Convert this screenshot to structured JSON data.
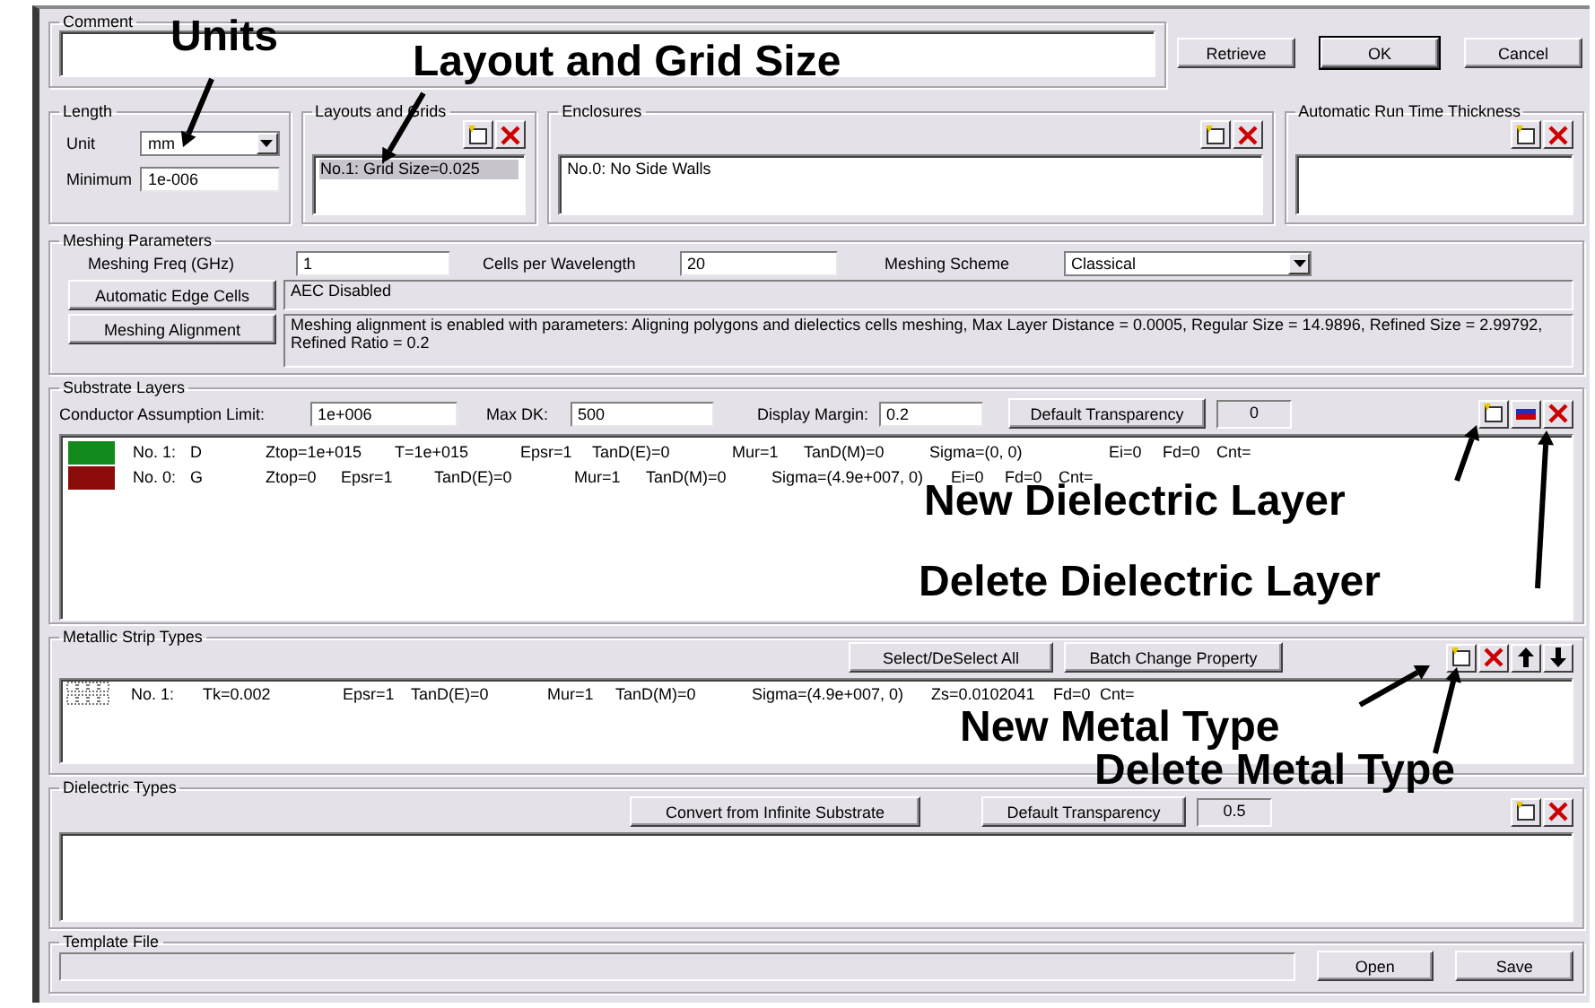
{
  "comment": {
    "label": "Comment"
  },
  "buttons": [
    {
      "label": "Retrieve",
      "default": false
    },
    {
      "label": "OK",
      "default": true
    },
    {
      "label": "Cancel",
      "default": false
    }
  ],
  "length": {
    "label": "Length",
    "unit_label": "Unit",
    "unit": "mm",
    "minimum_label": "Minimum",
    "minimum": "1e-006"
  },
  "layouts": {
    "label": "Layouts and Grids",
    "items": [
      {
        "text": "No.1: Grid Size=0.025",
        "selected": true
      }
    ]
  },
  "enclosures": {
    "label": "Enclosures",
    "items": [
      {
        "text": "No.0: No Side Walls",
        "selected": false
      }
    ]
  },
  "run_time_thickness": {
    "label": "Automatic Run Time Thickness"
  },
  "meshing": {
    "label": "Meshing Parameters",
    "freq_label": "Meshing Freq (GHz)",
    "freq": "1",
    "cells_label": "Cells per Wavelength",
    "cells": "20",
    "scheme_label": "Meshing Scheme",
    "scheme": "Classical",
    "aec_button": "Automatic Edge Cells",
    "aec_text": "AEC Disabled",
    "align_button": "Meshing Alignment",
    "align_text": "Meshing alignment is enabled with parameters: Aligning polygons and dielectics cells meshing, Max Layer Distance = 0.0005, Regular Size = 14.9896, Refined Size = 2.99792, Refined Ratio = 0.2"
  },
  "substrate": {
    "label": "Substrate Layers",
    "fields": [
      {
        "label": "Conductor Assumption Limit:",
        "value": "1e+006"
      },
      {
        "label": "Max DK:",
        "value": "500"
      },
      {
        "label": "Display Margin:",
        "value": "0.2"
      }
    ],
    "transparency_button": "Default Transparency",
    "transparency": "0",
    "layers": [
      {
        "color": "#138a1c",
        "cells": [
          "No. 1:",
          "D",
          "Ztop=1e+015",
          "T=1e+015",
          "Epsr=1",
          "TanD(E)=0",
          "Mur=1",
          "TanD(M)=0",
          "Sigma=(0, 0)",
          "Ei=0",
          "Fd=0",
          "Cnt="
        ]
      },
      {
        "color": "#8b0a0a",
        "cells": [
          "No. 0:",
          "G",
          "Ztop=0",
          "Epsr=1",
          "TanD(E)=0",
          "Mur=1",
          "TanD(M)=0",
          "Sigma=(4.9e+007, 0)",
          "Ei=0",
          "Fd=0",
          "Cnt="
        ]
      }
    ]
  },
  "metallic": {
    "label": "Metallic Strip Types",
    "select_button": "Select/DeSelect All",
    "batch_button": "Batch Change Property",
    "types": [
      {
        "cells": [
          "No. 1:",
          "Tk=0.002",
          "Epsr=1",
          "TanD(E)=0",
          "Mur=1",
          "TanD(M)=0",
          "Sigma=(4.9e+007, 0)",
          "Zs=0.0102041",
          "Fd=0",
          "Cnt="
        ]
      }
    ]
  },
  "dielectric": {
    "label": "Dielectric Types",
    "convert_button": "Convert from Infinite Substrate",
    "transparency_button": "Default Transparency",
    "transparency": "0.5"
  },
  "template": {
    "label": "Template File",
    "open_button": "Open",
    "save_button": "Save"
  },
  "annotations": [
    {
      "text": "Units"
    },
    {
      "text": "Layout and Grid Size"
    },
    {
      "text": "New Dielectric Layer"
    },
    {
      "text": "Delete Dielectric Layer"
    },
    {
      "text": "New Metal Type"
    },
    {
      "text": "Delete Metal Type"
    }
  ]
}
